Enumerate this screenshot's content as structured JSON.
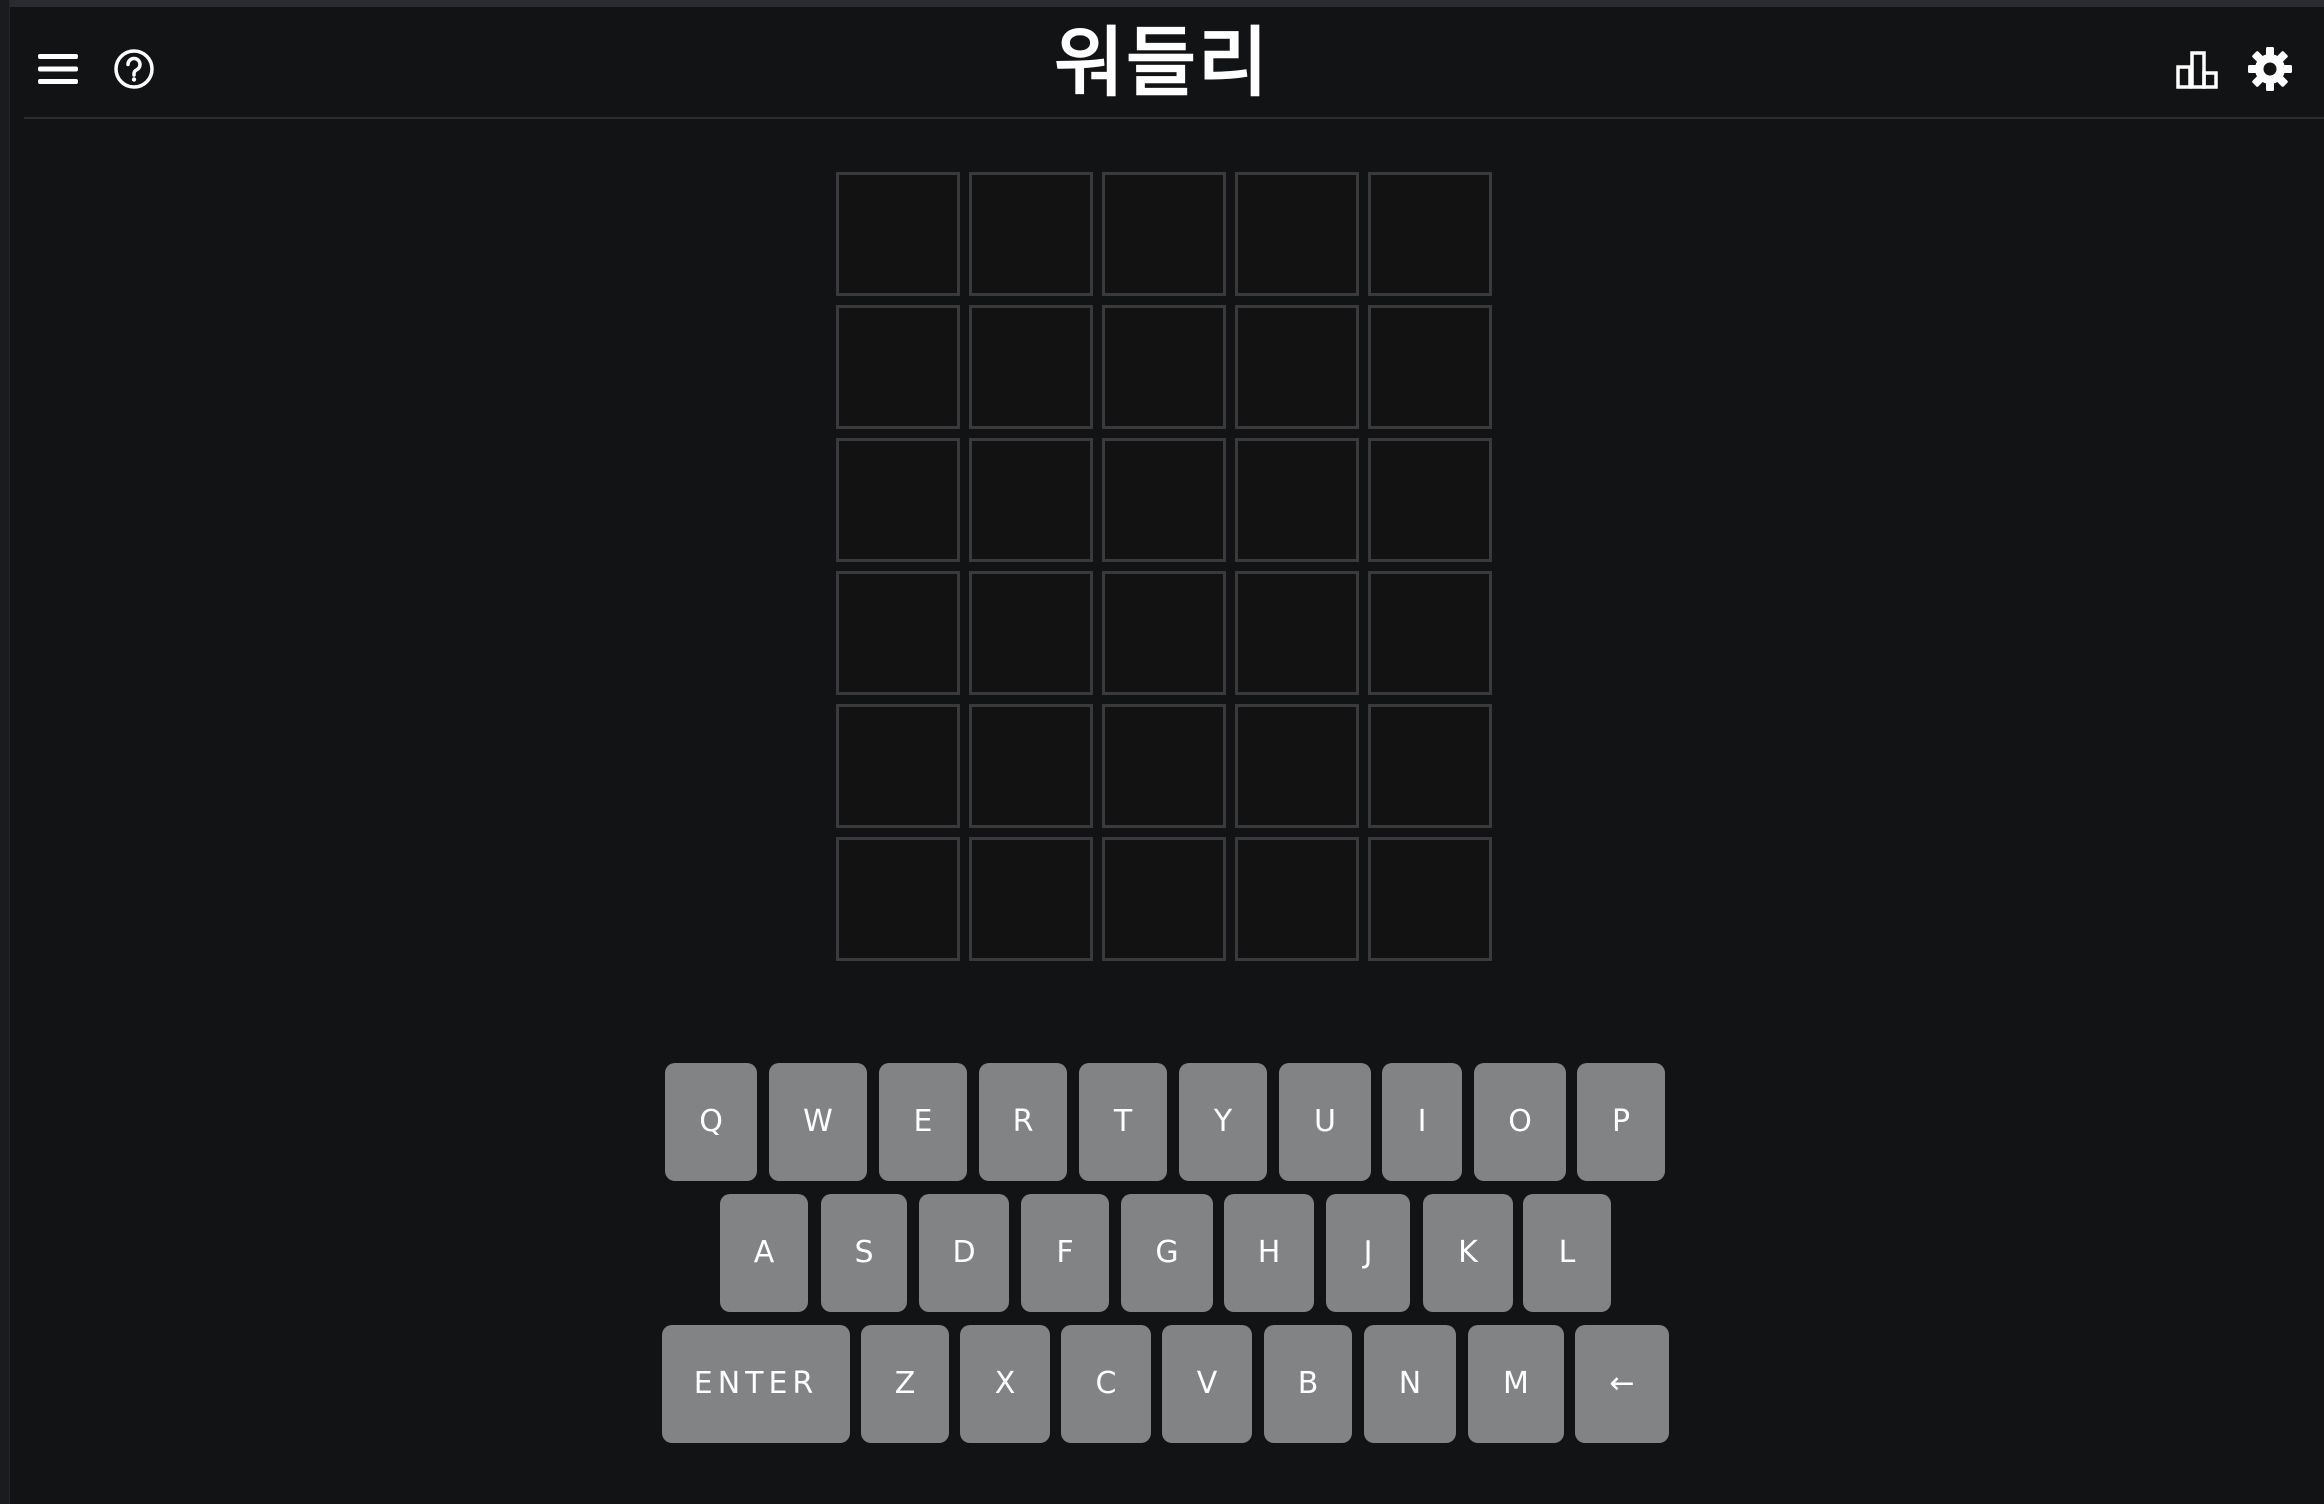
{
  "header": {
    "title": "워들리",
    "menu_icon": "hamburger-menu-icon",
    "help_icon": "help-circle-icon",
    "stats_icon": "bar-chart-icon",
    "settings_icon": "gear-icon"
  },
  "board": {
    "rows": 6,
    "cols": 5,
    "tiles": [
      [
        "",
        "",
        "",
        "",
        ""
      ],
      [
        "",
        "",
        "",
        "",
        ""
      ],
      [
        "",
        "",
        "",
        "",
        ""
      ],
      [
        "",
        "",
        "",
        "",
        ""
      ],
      [
        "",
        "",
        "",
        "",
        ""
      ],
      [
        "",
        "",
        "",
        "",
        ""
      ]
    ]
  },
  "keyboard": {
    "rows": [
      [
        "Q",
        "W",
        "E",
        "R",
        "T",
        "Y",
        "U",
        "I",
        "O",
        "P"
      ],
      [
        "A",
        "S",
        "D",
        "F",
        "G",
        "H",
        "J",
        "K",
        "L"
      ],
      [
        "ENTER",
        "Z",
        "X",
        "C",
        "V",
        "B",
        "N",
        "M",
        "←"
      ]
    ]
  },
  "colors": {
    "background": "#121315",
    "tile_border": "#3a3a3c",
    "key_background": "#818384",
    "text": "#ffffff"
  }
}
